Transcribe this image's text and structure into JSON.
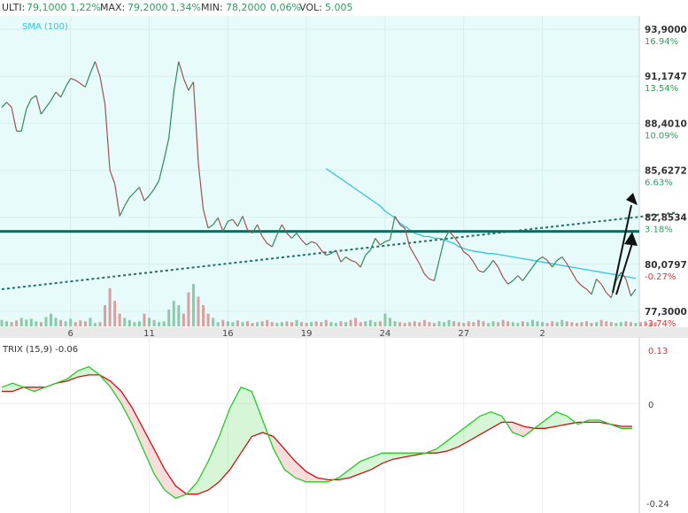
{
  "header": {
    "ulti_label": "ULTI:",
    "ulti_value": "79,1000",
    "ulti_pct": "1,22%",
    "max_label": "MAX:",
    "max_value": "79,2000",
    "max_pct": "1,34%",
    "min_label": "MIN:",
    "min_value": "78,2000",
    "min_pct": "0,06%",
    "vol_label": "VOL:",
    "vol_value": "5.005"
  },
  "colors": {
    "up": "#2e8b57",
    "down": "#a0524f",
    "sma": "#35c7d8",
    "resistance": "#0e6b5e",
    "trend": "#1f6f66",
    "trix_fast": "#22cc22",
    "trix_slow": "#cc1111"
  },
  "chart_data": [
    {
      "type": "line",
      "sma_label": "SMA (100)",
      "y_ticks": [
        {
          "price": "93,9000",
          "pct": "16.94%"
        },
        {
          "price": "91,1747",
          "pct": "13.54%"
        },
        {
          "price": "88,4010",
          "pct": "10.09%"
        },
        {
          "price": "85,6272",
          "pct": "6.63%"
        },
        {
          "price": "82,8534",
          "pct": "3.18%"
        },
        {
          "price": "80,0797",
          "pct": "-0.27%"
        },
        {
          "price": "77,3000",
          "pct": "-3.74%"
        }
      ],
      "ylim": [
        77.3,
        93.9
      ],
      "x_tick_labels": [
        "6",
        "11",
        "16",
        "19",
        "24",
        "27",
        "2"
      ],
      "x_tick_index": [
        14,
        30,
        46,
        62,
        78,
        94,
        110
      ],
      "price": [
        89.3,
        89.6,
        89.3,
        87.9,
        87.9,
        89.2,
        89.8,
        90.0,
        88.9,
        89.3,
        89.7,
        90.2,
        89.9,
        90.5,
        91.0,
        90.9,
        90.7,
        90.5,
        91.3,
        92.0,
        91.1,
        89.5,
        85.6,
        84.8,
        82.9,
        83.5,
        84.0,
        84.3,
        84.6,
        83.8,
        84.1,
        84.5,
        85.0,
        86.2,
        87.5,
        90.2,
        92.0,
        91.0,
        90.3,
        90.8,
        86.0,
        83.3,
        82.2,
        82.4,
        82.8,
        82.0,
        82.6,
        82.7,
        82.3,
        82.9,
        82.1,
        81.9,
        82.4,
        81.7,
        81.3,
        81.1,
        81.8,
        82.4,
        81.9,
        81.6,
        81.9,
        81.5,
        81.2,
        81.4,
        81.3,
        80.9,
        80.6,
        80.7,
        80.9,
        80.2,
        80.5,
        80.3,
        80.2,
        79.9,
        80.6,
        80.9,
        81.6,
        81.2,
        81.4,
        81.5,
        82.9,
        82.4,
        82.2,
        81.1,
        80.6,
        80.1,
        79.5,
        79.2,
        79.1,
        80.3,
        81.5,
        82.0,
        81.7,
        81.3,
        80.8,
        80.6,
        80.2,
        79.7,
        79.6,
        79.9,
        80.3,
        79.9,
        79.3,
        78.9,
        79.1,
        79.4,
        79.1,
        79.5,
        79.9,
        80.3,
        80.5,
        80.3,
        79.9,
        80.3,
        80.5,
        80.1,
        79.6,
        79.1,
        78.8,
        78.6,
        78.3,
        79.2,
        78.9,
        78.4,
        78.1,
        79.1,
        79.6,
        79.2,
        78.2,
        78.6
      ],
      "sma": [
        null,
        null,
        null,
        null,
        null,
        null,
        null,
        null,
        null,
        null,
        null,
        null,
        null,
        null,
        null,
        null,
        null,
        null,
        null,
        null,
        null,
        null,
        null,
        null,
        null,
        null,
        null,
        null,
        null,
        null,
        null,
        null,
        null,
        null,
        null,
        null,
        null,
        null,
        null,
        null,
        null,
        null,
        null,
        null,
        null,
        null,
        null,
        null,
        null,
        null,
        null,
        null,
        null,
        null,
        null,
        null,
        null,
        null,
        null,
        null,
        null,
        null,
        null,
        null,
        null,
        null,
        85.7,
        85.5,
        85.3,
        85.1,
        84.9,
        84.7,
        84.5,
        84.3,
        84.1,
        83.9,
        83.7,
        83.5,
        83.2,
        83.0,
        82.8,
        82.5,
        82.3,
        82.1,
        81.9,
        81.8,
        81.7,
        81.7,
        81.6,
        81.6,
        81.5,
        81.4,
        81.3,
        81.1,
        81.0,
        80.9,
        80.85,
        80.8,
        80.75,
        80.7,
        80.7,
        80.65,
        80.6,
        80.55,
        80.5,
        80.45,
        80.4,
        80.35,
        80.3,
        80.25,
        80.2,
        80.15,
        80.1,
        80.05,
        80.0,
        79.95,
        79.9,
        79.85,
        79.8,
        79.75,
        79.7,
        79.65,
        79.6,
        79.55,
        79.5,
        79.45,
        79.4,
        79.35,
        79.3,
        79.25
      ],
      "resistance_level": 82.0,
      "trend_line": {
        "from": [
          0,
          78.6
        ],
        "to": [
          137,
          83.1
        ]
      },
      "volume": [
        0.15,
        0.12,
        0.1,
        0.14,
        0.2,
        0.16,
        0.18,
        0.12,
        0.1,
        0.22,
        0.3,
        0.2,
        0.15,
        0.12,
        0.18,
        0.1,
        0.14,
        0.12,
        0.2,
        0.08,
        0.1,
        0.5,
        0.9,
        0.6,
        0.3,
        0.2,
        0.15,
        0.1,
        0.12,
        0.3,
        0.2,
        0.15,
        0.1,
        0.12,
        0.4,
        0.6,
        0.5,
        0.3,
        0.8,
        1.0,
        0.7,
        0.5,
        0.3,
        0.2,
        0.1,
        0.15,
        0.12,
        0.1,
        0.14,
        0.1,
        0.12,
        0.08,
        0.1,
        0.12,
        0.15,
        0.1,
        0.08,
        0.1,
        0.12,
        0.1,
        0.15,
        0.1,
        0.08,
        0.1,
        0.12,
        0.1,
        0.15,
        0.1,
        0.08,
        0.12,
        0.1,
        0.15,
        0.2,
        0.1,
        0.12,
        0.15,
        0.1,
        0.12,
        0.3,
        0.2,
        0.12,
        0.1,
        0.08,
        0.1,
        0.12,
        0.1,
        0.15,
        0.1,
        0.08,
        0.12,
        0.1,
        0.15,
        0.12,
        0.1,
        0.08,
        0.12,
        0.1,
        0.15,
        0.12,
        0.08,
        0.12,
        0.1,
        0.15,
        0.12,
        0.1,
        0.08,
        0.12,
        0.1,
        0.15,
        0.12,
        0.1,
        0.08,
        0.12,
        0.1,
        0.15,
        0.12,
        0.1,
        0.08,
        0.1,
        0.12,
        0.08,
        0.1,
        0.15,
        0.12,
        0.1,
        0.08,
        0.1,
        0.12,
        0.1,
        0.08,
        0.1,
        0.12,
        0.08,
        0.1
      ]
    },
    {
      "type": "line",
      "label": "TRIX (15,9) -0.06",
      "y_ticks": [
        "0.13",
        "0",
        "-0.24"
      ],
      "ylim": [
        -0.24,
        0.13
      ],
      "trix": [
        0.04,
        0.05,
        0.04,
        0.03,
        0.04,
        0.05,
        0.06,
        0.08,
        0.09,
        0.07,
        0.04,
        0.0,
        -0.05,
        -0.11,
        -0.17,
        -0.21,
        -0.23,
        -0.22,
        -0.19,
        -0.14,
        -0.08,
        -0.01,
        0.04,
        0.03,
        -0.04,
        -0.11,
        -0.16,
        -0.18,
        -0.19,
        -0.19,
        -0.19,
        -0.18,
        -0.16,
        -0.14,
        -0.13,
        -0.12,
        -0.12,
        -0.12,
        -0.12,
        -0.12,
        -0.11,
        -0.09,
        -0.07,
        -0.05,
        -0.03,
        -0.02,
        -0.03,
        -0.07,
        -0.08,
        -0.06,
        -0.04,
        -0.02,
        -0.03,
        -0.05,
        -0.04,
        -0.04,
        -0.05,
        -0.06,
        -0.06
      ],
      "trix_signal": [
        0.03,
        0.03,
        0.04,
        0.04,
        0.04,
        0.05,
        0.055,
        0.065,
        0.07,
        0.07,
        0.055,
        0.03,
        -0.01,
        -0.06,
        -0.11,
        -0.16,
        -0.2,
        -0.22,
        -0.22,
        -0.21,
        -0.19,
        -0.16,
        -0.12,
        -0.08,
        -0.07,
        -0.08,
        -0.11,
        -0.14,
        -0.165,
        -0.18,
        -0.185,
        -0.185,
        -0.18,
        -0.17,
        -0.16,
        -0.145,
        -0.135,
        -0.13,
        -0.125,
        -0.12,
        -0.12,
        -0.115,
        -0.105,
        -0.09,
        -0.075,
        -0.06,
        -0.045,
        -0.045,
        -0.055,
        -0.06,
        -0.06,
        -0.055,
        -0.05,
        -0.045,
        -0.045,
        -0.045,
        -0.05,
        -0.055,
        -0.055
      ]
    }
  ]
}
